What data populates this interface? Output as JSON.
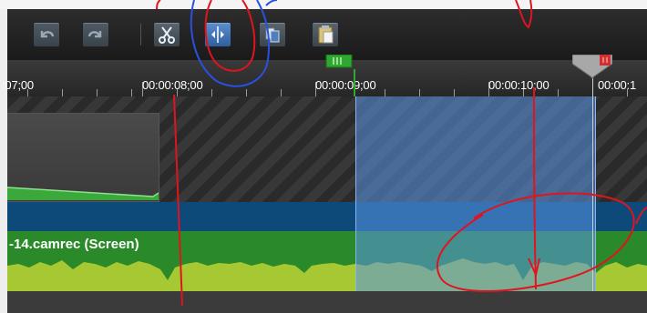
{
  "toolbar": {
    "buttons": [
      {
        "name": "undo",
        "icon": "undo-icon"
      },
      {
        "name": "redo",
        "icon": "redo-icon"
      },
      {
        "name": "cut",
        "icon": "scissors-icon"
      },
      {
        "name": "split",
        "icon": "split-icon"
      },
      {
        "name": "copy",
        "icon": "copy-icon"
      },
      {
        "name": "paste",
        "icon": "paste-icon"
      }
    ]
  },
  "ruler": {
    "labels": [
      ":07;00",
      "00:00:08;00",
      "00:00:09;00",
      "00:00:10;00",
      "00:00:1"
    ]
  },
  "tracks": {
    "audio_clip_label": "-14.camrec (Screen)"
  },
  "colors": {
    "toolbar_bg": "#1f1f1f",
    "selection": "#5a96e6",
    "audio_green": "#2a8a2a",
    "waveform_lime": "#a6c832",
    "annotation_red": "#e0141e",
    "annotation_blue": "#2a50e0",
    "in_marker": "#2ea82e",
    "out_marker": "#d03030"
  }
}
